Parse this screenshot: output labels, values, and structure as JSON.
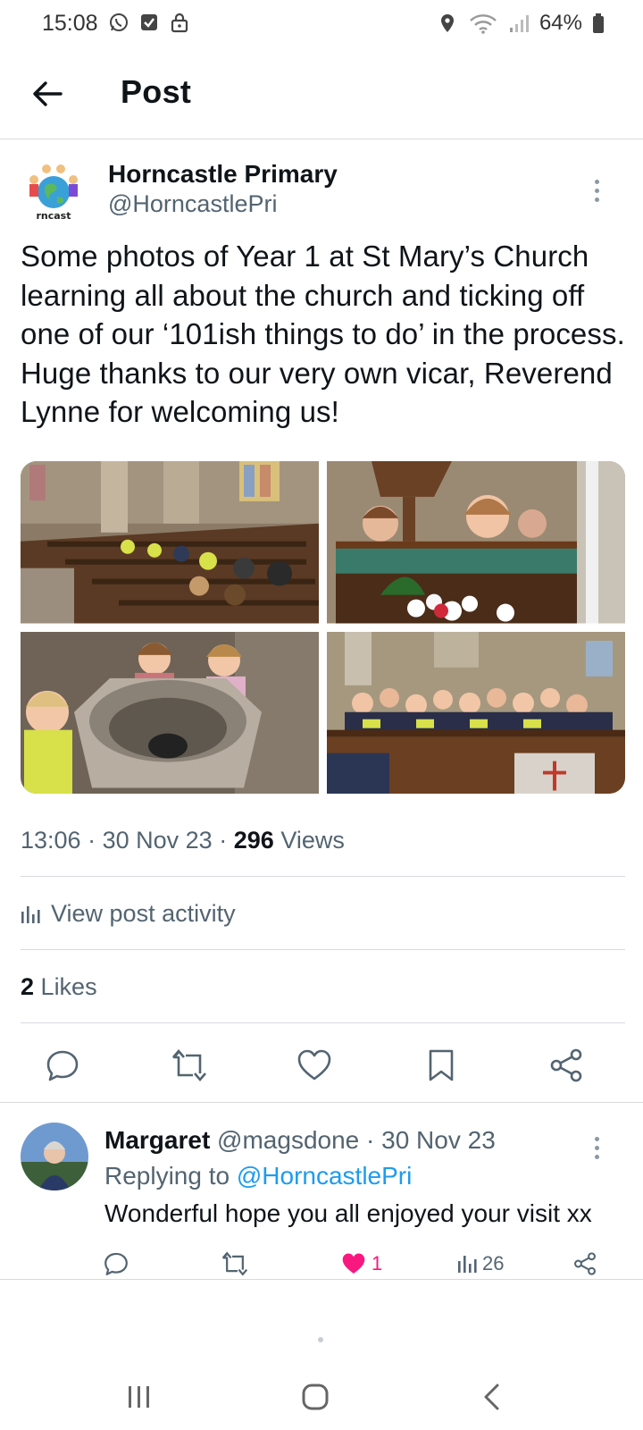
{
  "status_bar": {
    "time": "15:08",
    "battery": "64%",
    "icons": [
      "whatsapp-icon",
      "checkbox-notification-icon",
      "lock-icon",
      "location-icon",
      "wifi-icon",
      "signal-icon",
      "battery-icon"
    ]
  },
  "header": {
    "title": "Post",
    "back_icon": "arrow-left-icon"
  },
  "post": {
    "author_name": "Horncastle Primary",
    "author_handle": "@HorncastlePri",
    "avatar_text": "rncast",
    "text": "Some photos of Year 1 at St Mary’s Church learning all about the church and ticking off one of our ‘101ish things to do’ in the process. Huge thanks to our very own vicar, Reverend Lynne for welcoming us!",
    "photos": [
      {
        "name": "photo-church-pews-children"
      },
      {
        "name": "photo-children-at-pulpit"
      },
      {
        "name": "photo-children-at-font"
      },
      {
        "name": "photo-children-in-pews"
      }
    ],
    "time": "13:06",
    "date": "30 Nov 23",
    "views_count": "296",
    "views_label": "Views",
    "activity_label": "View post activity",
    "likes_count": "2",
    "likes_label": "Likes",
    "sep": "·"
  },
  "actions": [
    "reply-icon",
    "repost-icon",
    "like-icon",
    "bookmark-icon",
    "share-icon"
  ],
  "reply": {
    "name": "Margaret",
    "handle": "@magsdone",
    "date": "30 Nov 23",
    "sep": "·",
    "replying_prefix": "Replying to",
    "replying_to": "@HorncastlePri",
    "text": "Wonderful hope you all enjoyed your visit xx",
    "likes": "1",
    "views": "26"
  },
  "colors": {
    "accent": "#1d9bf0",
    "like": "#f91880",
    "secondary_text": "#536471",
    "divider": "#d7dbdf"
  }
}
